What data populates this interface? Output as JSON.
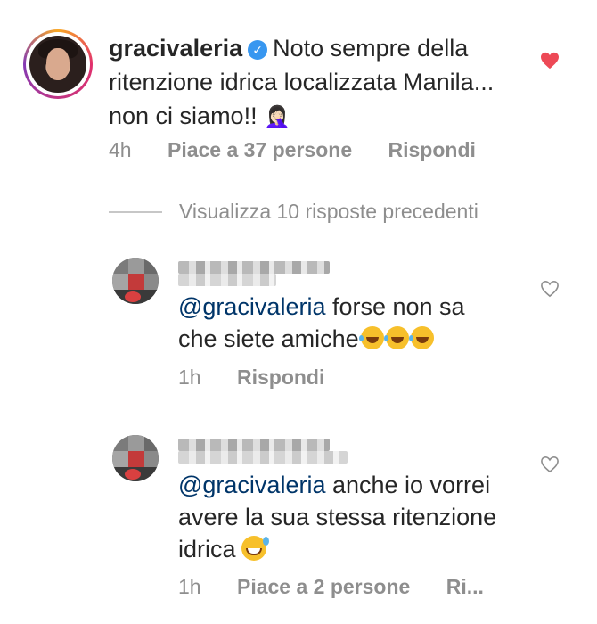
{
  "main_comment": {
    "username": "gracivaleria",
    "text": "Noto sempre della ritenzione idrica localizzata Manila... non ci siamo!!",
    "emoji": "🤦🏻‍♀️",
    "time": "4h",
    "likes": "Piace a 37 persone",
    "reply_label": "Rispondi",
    "liked": true
  },
  "view_replies": "Visualizza 10 risposte precedenti",
  "replies": [
    {
      "mention": "@gracivaleria",
      "text": " forse non sa che siete amiche",
      "time": "1h",
      "reply_label": "Rispondi"
    },
    {
      "mention": "@gracivaleria",
      "text": " anche io vorrei avere la sua stessa ritenzione idrica",
      "time": "1h",
      "likes": "Piace a 2 persone",
      "reply_label": "Ri..."
    }
  ],
  "colors": {
    "like_red": "#ed4956",
    "mention_blue": "#003569",
    "meta_gray": "#8e8e8e",
    "verified_blue": "#3897f0"
  },
  "icons": [
    "heart-filled-icon",
    "heart-outline-icon",
    "verified-badge-icon"
  ]
}
